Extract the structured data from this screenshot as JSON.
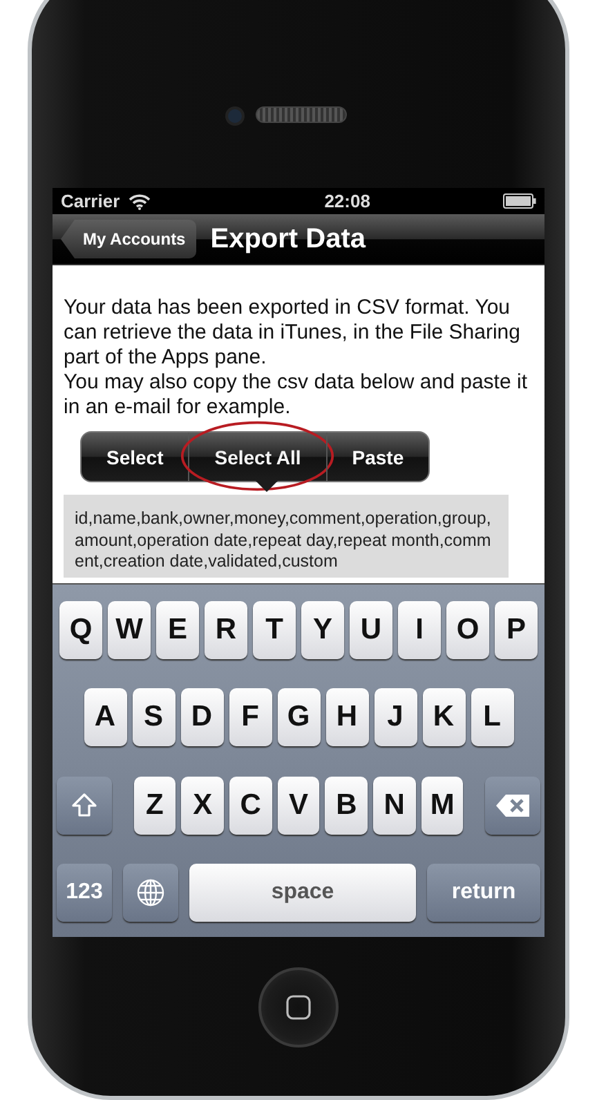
{
  "status_bar": {
    "carrier": "Carrier",
    "time": "22:08"
  },
  "nav_bar": {
    "back_button": "My Accounts",
    "title": "Export Data"
  },
  "message": [
    "Your data has been exported in CSV format. You can retrieve the data in iTunes, in the File Sharing part of the Apps pane.",
    "You may also copy the csv data below and paste it in an e-mail for example."
  ],
  "edit_menu": [
    {
      "label": "Select",
      "highlighted": false
    },
    {
      "label": "Select All",
      "highlighted": true
    },
    {
      "label": "Paste",
      "highlighted": false
    }
  ],
  "csv_text": "id,name,bank,owner,money,comment,operation,group,amount,operation date,repeat day,repeat month,comment,creation date,validated,custom",
  "keyboard": {
    "rows": [
      {
        "keys": [
          {
            "kind": "letter",
            "label": "Q"
          },
          {
            "kind": "letter",
            "label": "W"
          },
          {
            "kind": "letter",
            "label": "E"
          },
          {
            "kind": "letter",
            "label": "R"
          },
          {
            "kind": "letter",
            "label": "T"
          },
          {
            "kind": "letter",
            "label": "Y"
          },
          {
            "kind": "letter",
            "label": "U"
          },
          {
            "kind": "letter",
            "label": "I"
          },
          {
            "kind": "letter",
            "label": "O"
          },
          {
            "kind": "letter",
            "label": "P"
          }
        ]
      },
      {
        "keys": [
          {
            "kind": "letter",
            "label": "A"
          },
          {
            "kind": "letter",
            "label": "S"
          },
          {
            "kind": "letter",
            "label": "D"
          },
          {
            "kind": "letter",
            "label": "F"
          },
          {
            "kind": "letter",
            "label": "G"
          },
          {
            "kind": "letter",
            "label": "H"
          },
          {
            "kind": "letter",
            "label": "J"
          },
          {
            "kind": "letter",
            "label": "K"
          },
          {
            "kind": "letter",
            "label": "L"
          }
        ]
      },
      {
        "keys": [
          {
            "kind": "shift"
          },
          {
            "kind": "letter",
            "label": "Z"
          },
          {
            "kind": "letter",
            "label": "X"
          },
          {
            "kind": "letter",
            "label": "C"
          },
          {
            "kind": "letter",
            "label": "V"
          },
          {
            "kind": "letter",
            "label": "B"
          },
          {
            "kind": "letter",
            "label": "N"
          },
          {
            "kind": "letter",
            "label": "M"
          },
          {
            "kind": "delete"
          }
        ]
      },
      {
        "keys": [
          {
            "kind": "numbers",
            "label": "123"
          },
          {
            "kind": "globe"
          },
          {
            "kind": "space",
            "label": "space"
          },
          {
            "kind": "return",
            "label": "return"
          }
        ]
      }
    ]
  }
}
